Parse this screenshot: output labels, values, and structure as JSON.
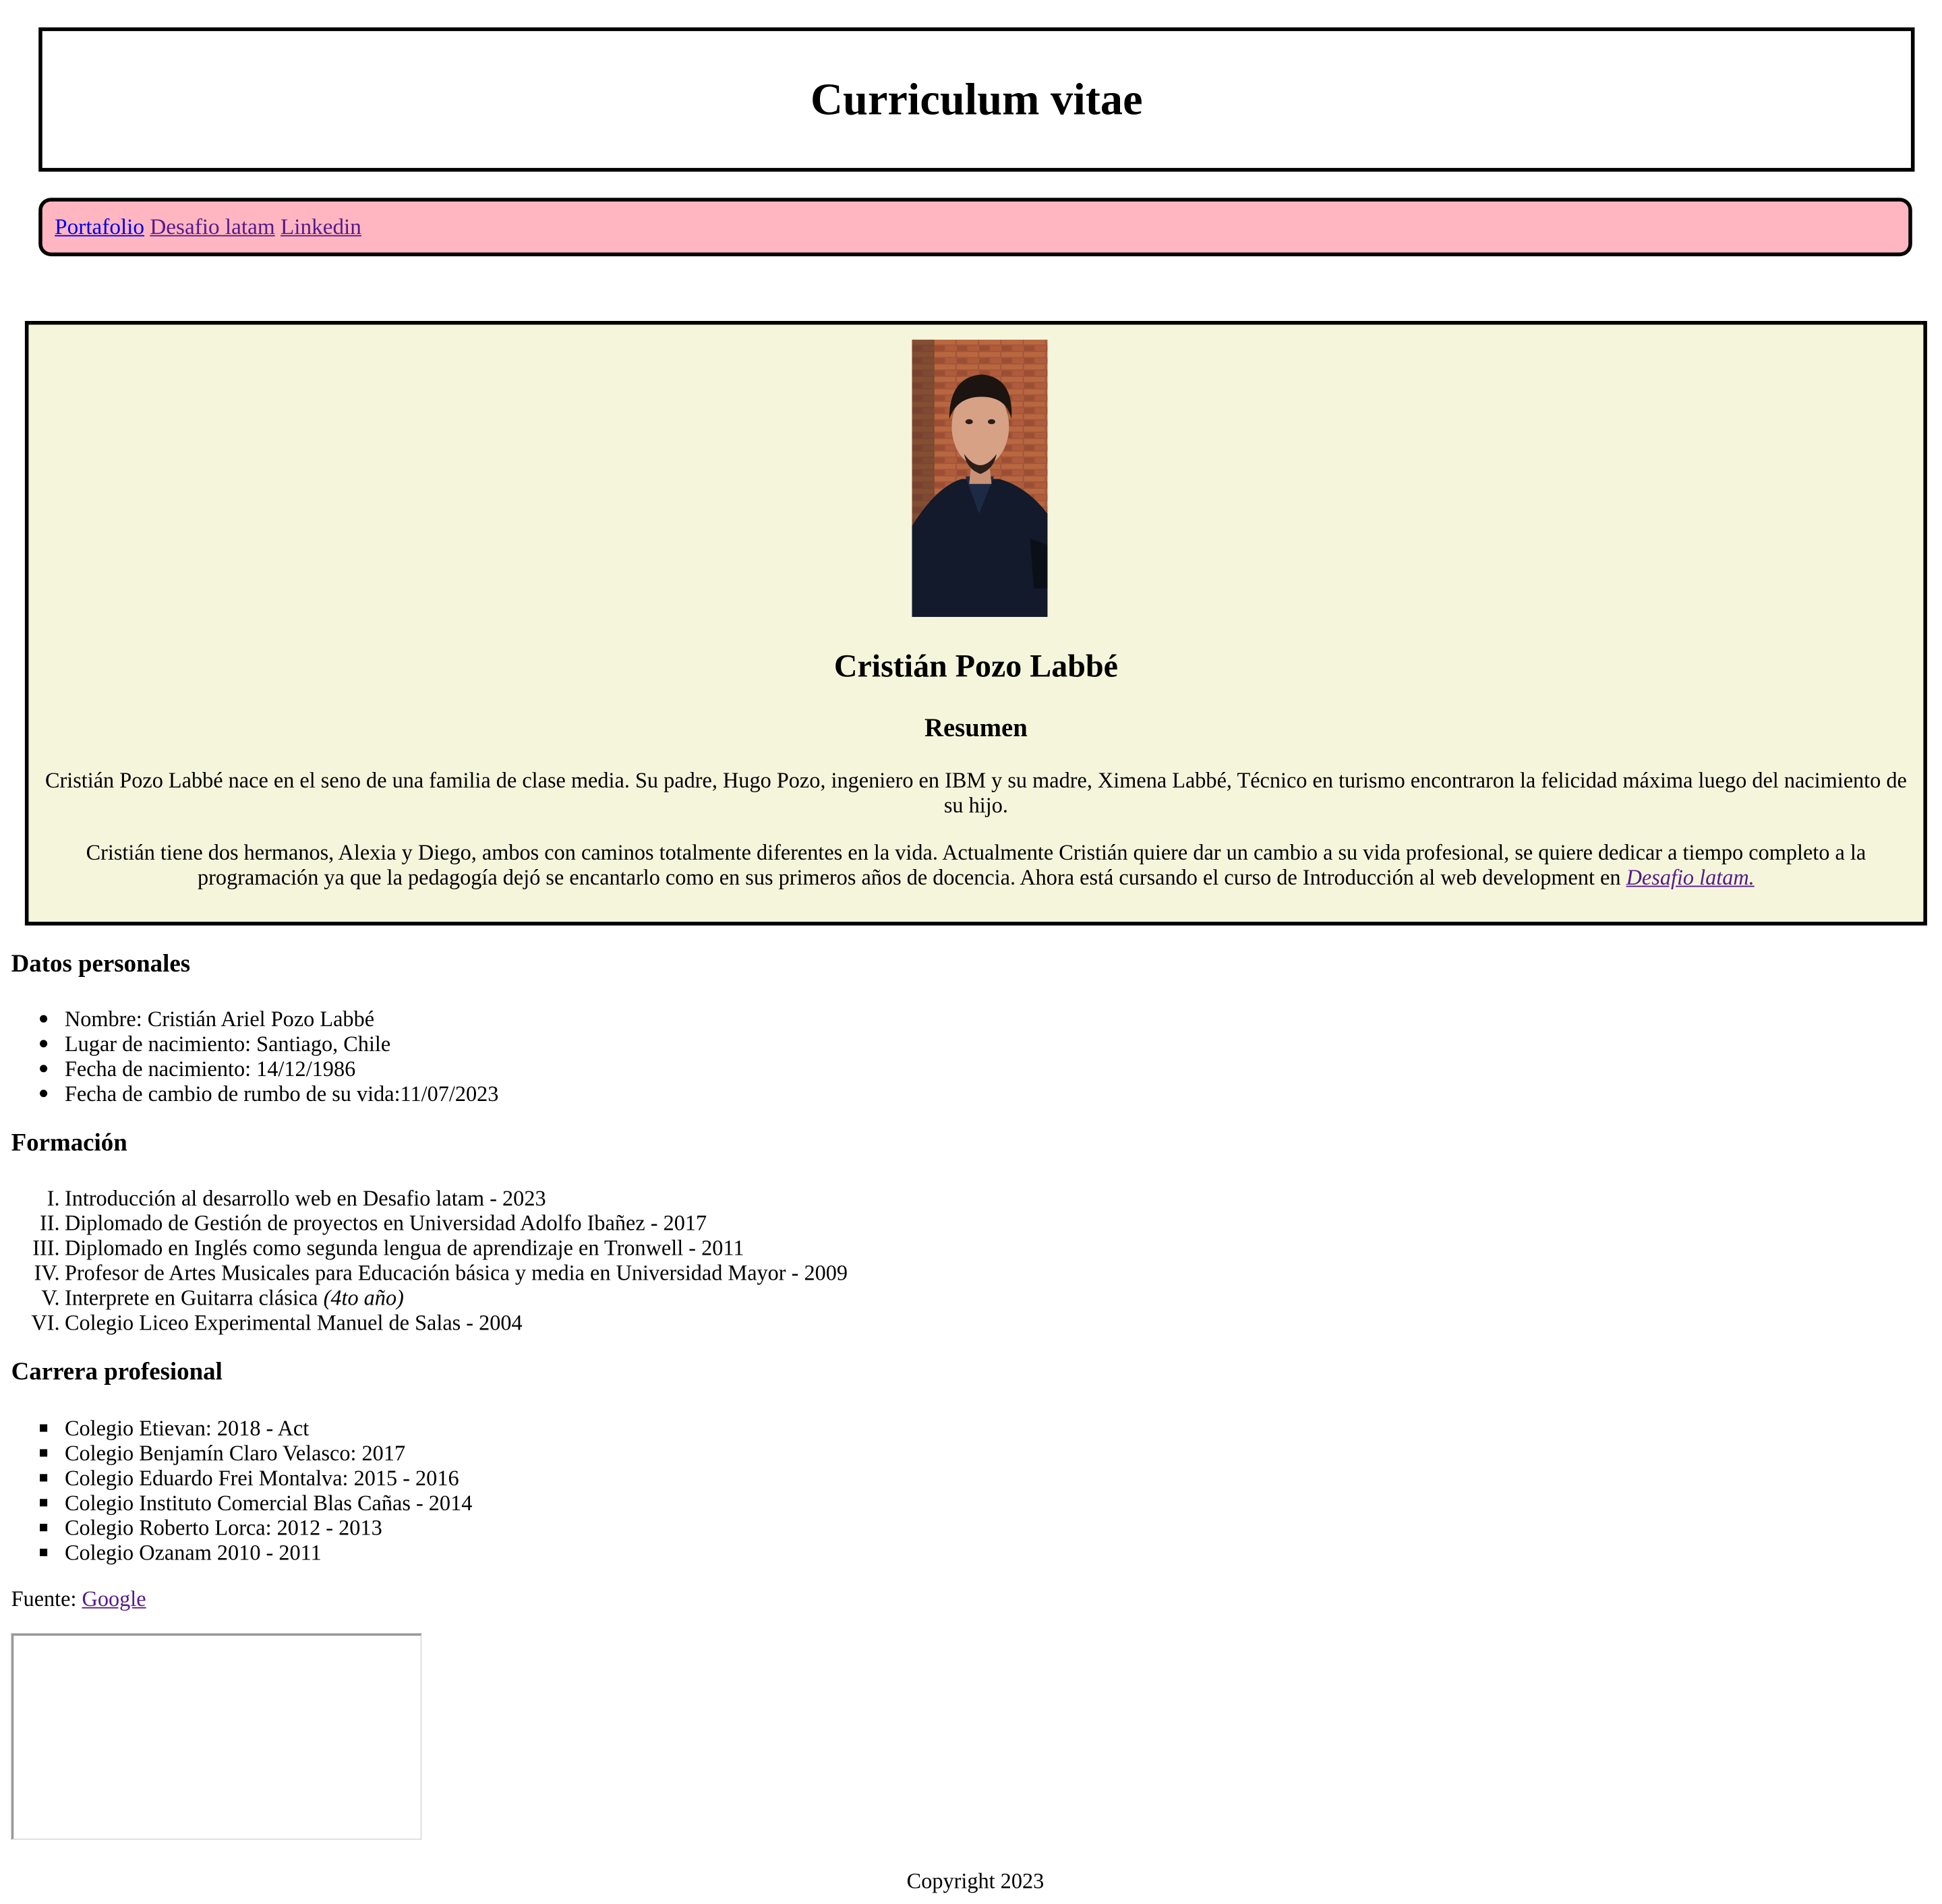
{
  "header": {
    "title": "Curriculum vitae"
  },
  "nav": {
    "links": [
      {
        "label": "Portafolio"
      },
      {
        "label": "Desafio latam"
      },
      {
        "label": "Linkedin"
      }
    ]
  },
  "profile": {
    "name": "Cristián Pozo Labbé",
    "summary_title": "Resumen",
    "paragraph1": "Cristián Pozo Labbé nace en el seno de una familia de clase media. Su padre, Hugo Pozo, ingeniero en IBM y su madre, Ximena Labbé, Técnico en turismo encontraron la felicidad máxima luego del nacimiento de su hijo.",
    "paragraph2_text": "Cristián tiene dos hermanos, Alexia y Diego, ambos con caminos totalmente diferentes en la vida. Actualmente Cristián quiere dar un cambio a su vida profesional, se quiere dedicar a tiempo completo a la programación ya que la pedagogía dejó se encantarlo como en sus primeros años de docencia. Ahora está cursando el curso de Introducción al web development en ",
    "paragraph2_link": "Desafio latam."
  },
  "personal": {
    "title": "Datos personales",
    "items": [
      "Nombre: Cristián Ariel Pozo Labbé",
      "Lugar de nacimiento: Santiago, Chile",
      "Fecha de nacimiento: 14/12/1986",
      "Fecha de cambio de rumbo de su vida:11/07/2023"
    ]
  },
  "education": {
    "title": "Formación",
    "items": [
      {
        "num": "I.",
        "text": "Introducción al desarrollo web en Desafio latam - 2023"
      },
      {
        "num": "II.",
        "text": "Diplomado de Gestión de proyectos en Universidad Adolfo Ibañez - 2017"
      },
      {
        "num": "III.",
        "text": "Diplomado en Inglés como segunda lengua de aprendizaje en Tronwell - 2011"
      },
      {
        "num": "IV.",
        "text": "Profesor de Artes Musicales para Educación básica y media en Universidad Mayor - 2009"
      },
      {
        "num": "V.",
        "text": "Interprete en Guitarra clásica ",
        "italic": "(4to año)"
      },
      {
        "num": "VI.",
        "text": "Colegio Liceo Experimental Manuel de Salas - 2004"
      }
    ]
  },
  "career": {
    "title": "Carrera profesional",
    "items": [
      "Colegio Etievan: 2018 - Act",
      "Colegio Benjamín Claro Velasco: 2017",
      "Colegio Eduardo Frei Montalva: 2015 - 2016",
      "Colegio Instituto Comercial Blas Cañas - 2014",
      "Colegio Roberto Lorca: 2012 - 2013",
      "Colegio Ozanam 2010 - 2011"
    ]
  },
  "source": {
    "label": "Fuente: ",
    "link": "Google"
  },
  "footer": {
    "text": "Copyright 2023"
  }
}
